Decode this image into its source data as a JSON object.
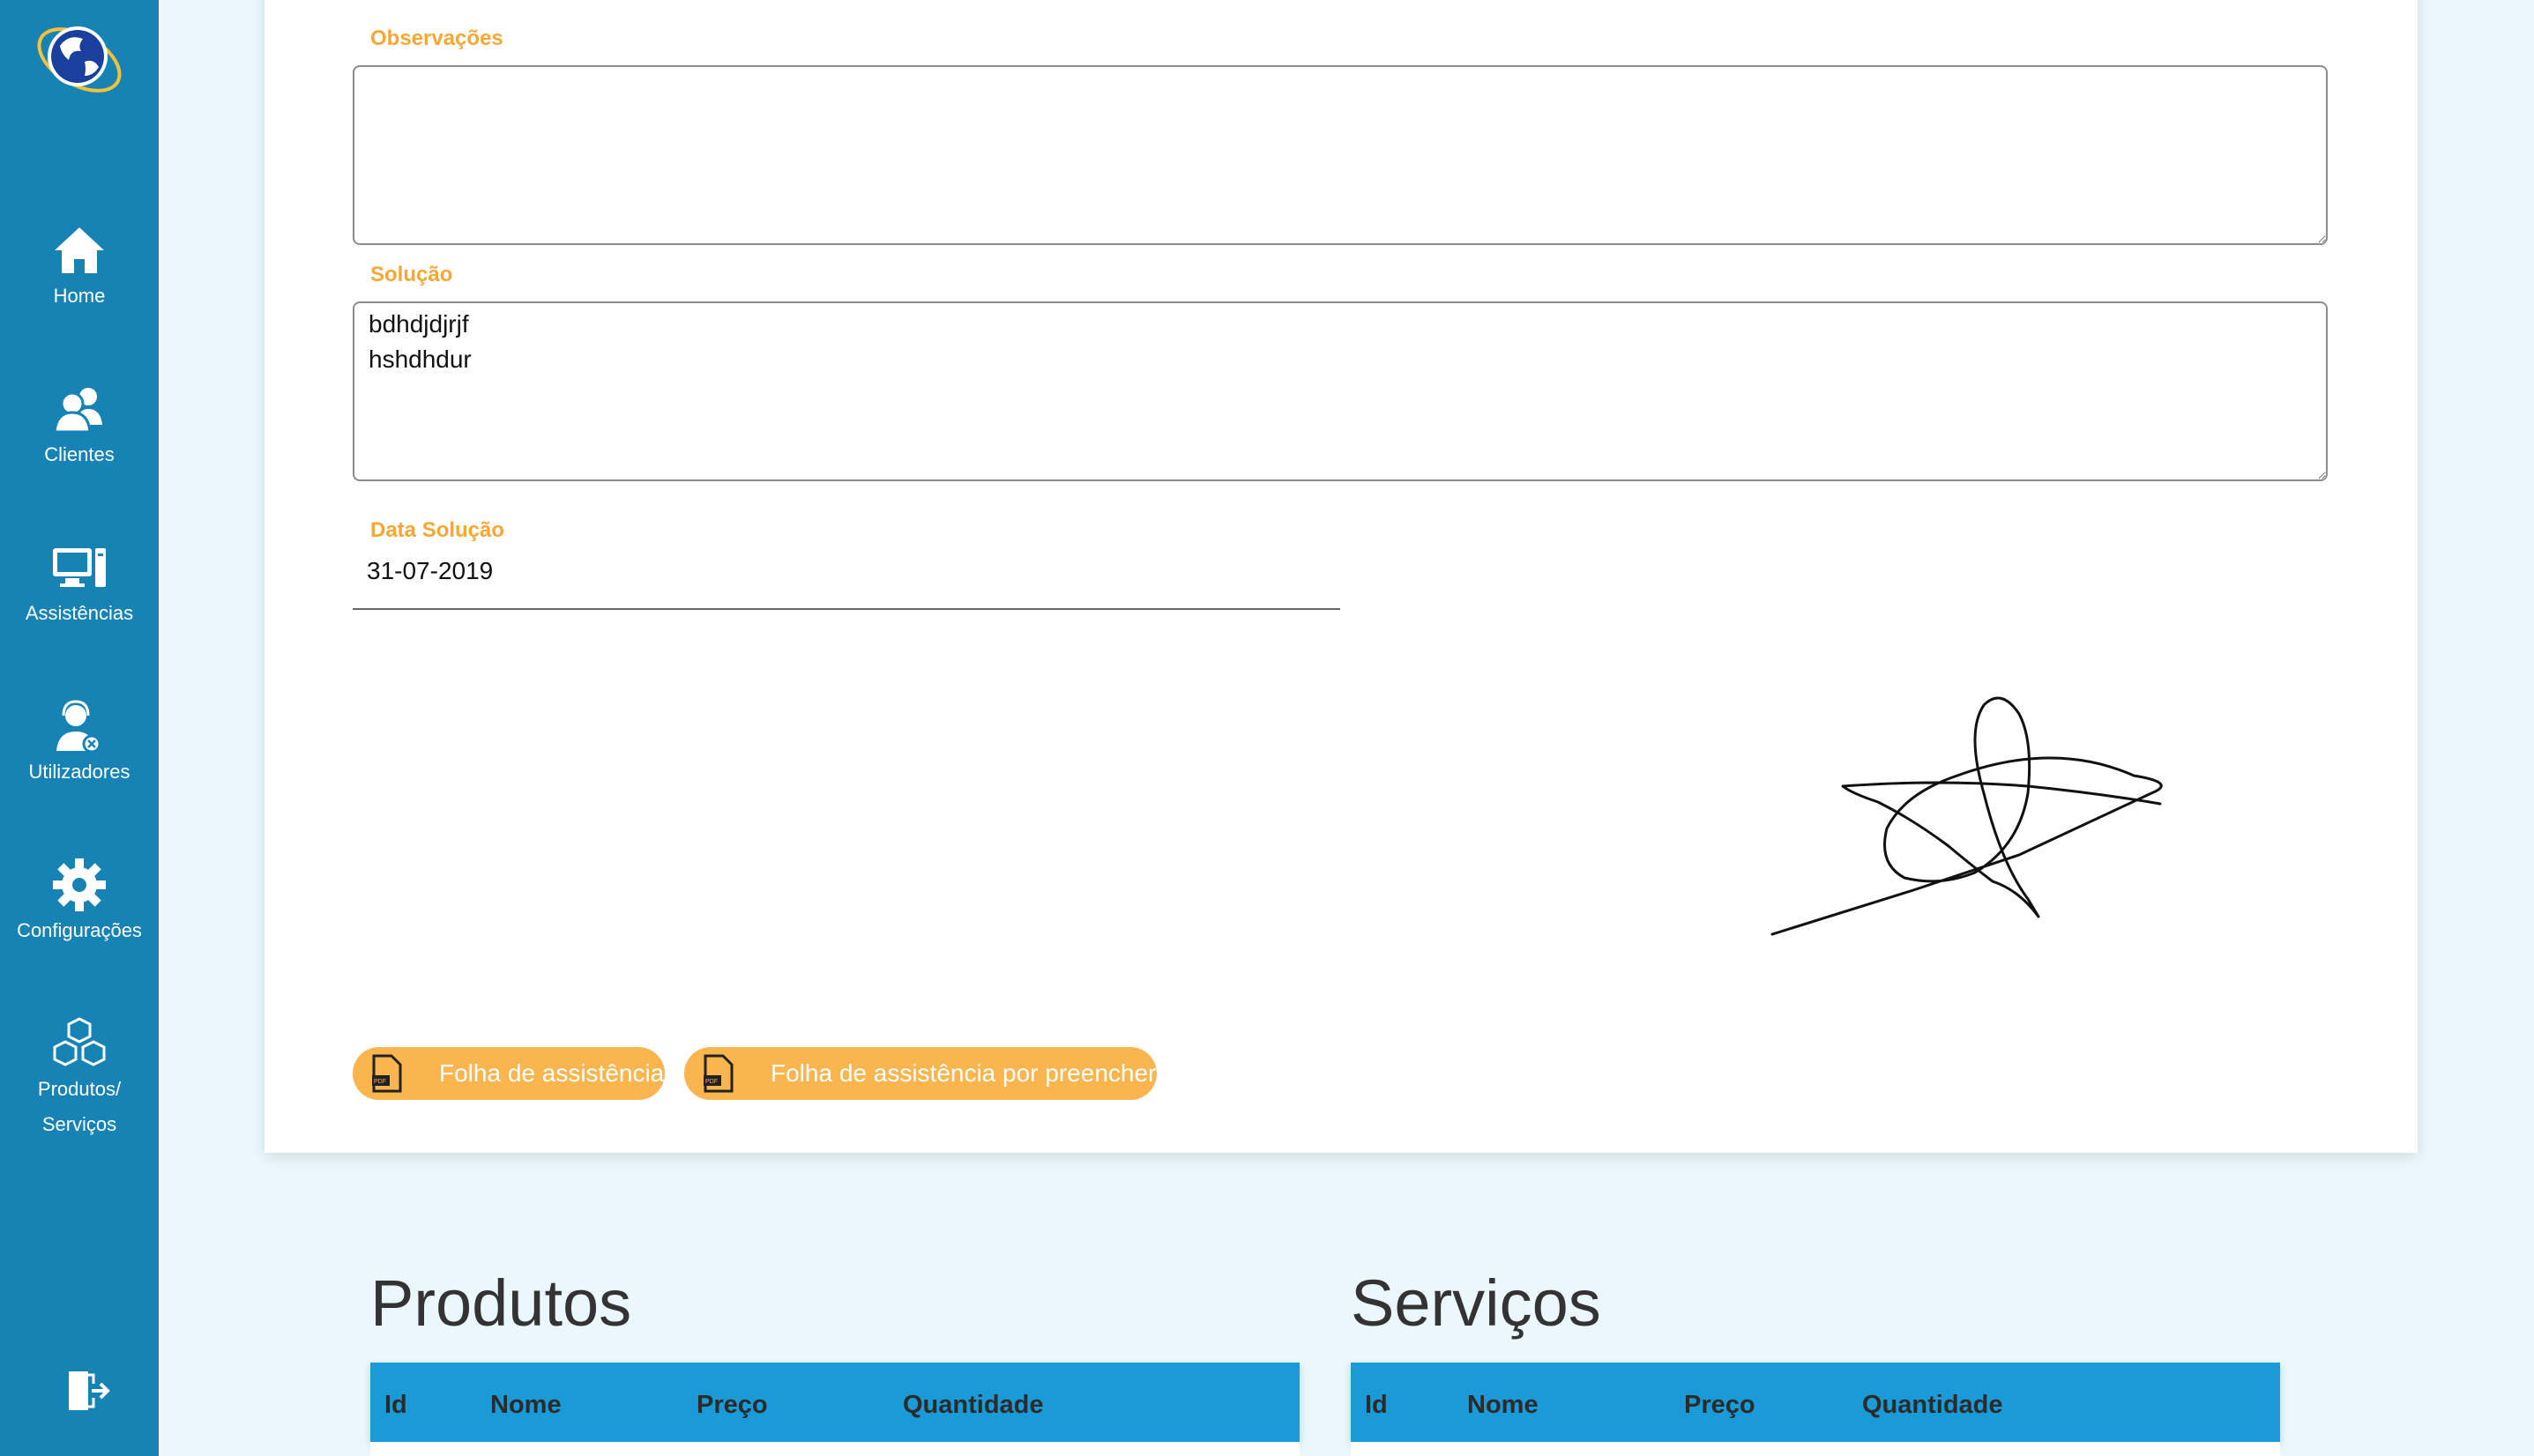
{
  "sidebar": {
    "items": [
      {
        "label": "Home",
        "icon": "home-icon"
      },
      {
        "label": "Clientes",
        "icon": "users-icon"
      },
      {
        "label": "Assistências",
        "icon": "computer-icon"
      },
      {
        "label": "Utilizadores",
        "icon": "support-user-icon"
      },
      {
        "label": "Configurações",
        "icon": "gear-icon"
      },
      {
        "label_line1": "Produtos/",
        "label_line2": "Serviços",
        "icon": "boxes-icon"
      }
    ],
    "logout_icon": "logout-icon"
  },
  "form": {
    "observacoes": {
      "label": "Observações",
      "value": ""
    },
    "solucao": {
      "label": "Solução",
      "value": "bdhdjdjrjf\nhshdhdur"
    },
    "data_solucao": {
      "label": "Data Solução",
      "value": "31-07-2019"
    }
  },
  "buttons": {
    "folha": "Folha de assistência",
    "folha_preencher": "Folha de assistência por preencher"
  },
  "produtos": {
    "title": "Produtos",
    "columns": [
      "Id",
      "Nome",
      "Preço",
      "Quantidade"
    ]
  },
  "servicos": {
    "title": "Serviços",
    "columns": [
      "Id",
      "Nome",
      "Preço",
      "Quantidade"
    ]
  },
  "colors": {
    "sidebar": "#1683b4",
    "accent": "#f7a733",
    "button": "#fbb54e",
    "table_header": "#1a9ad6",
    "background": "#eaf8fd"
  }
}
